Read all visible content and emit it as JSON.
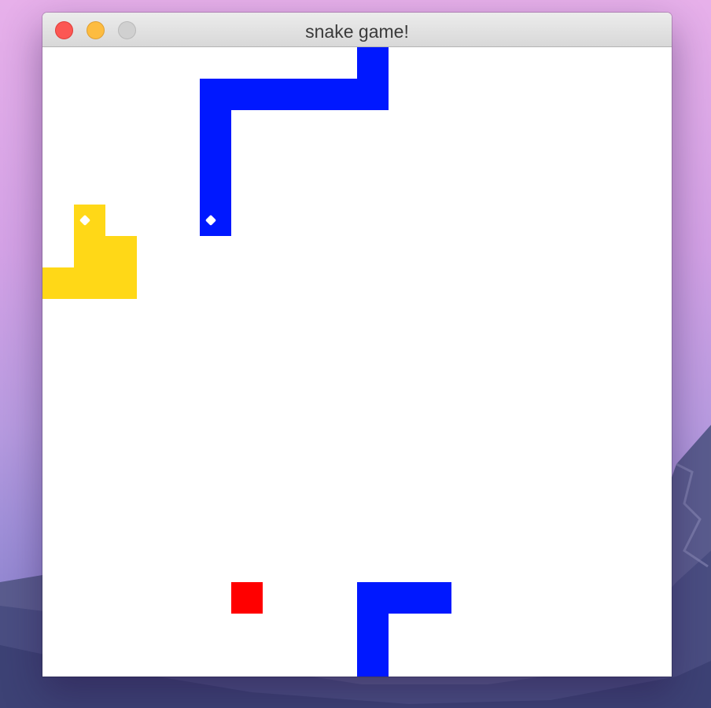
{
  "window": {
    "title": "snake game!"
  },
  "colors": {
    "board": "#ffffff",
    "player_snake": "#0018ff",
    "enemy_snake": "#ffd817",
    "food": "#ff0000",
    "eye": "#ffffff"
  },
  "game": {
    "grid_columns": 20,
    "grid_rows": 20,
    "snakes": [
      {
        "name": "blue-snake",
        "color": "#0018ff",
        "head": [
          5,
          5
        ],
        "direction": "down",
        "cells": [
          [
            5,
            5
          ],
          [
            5,
            4
          ],
          [
            5,
            3
          ],
          [
            5,
            2
          ],
          [
            6,
            1
          ],
          [
            7,
            1
          ],
          [
            8,
            1
          ],
          [
            9,
            1
          ],
          [
            10,
            1
          ],
          [
            10,
            0
          ],
          [
            5,
            1
          ],
          [
            10,
            19
          ],
          [
            10,
            18
          ],
          [
            11,
            17
          ],
          [
            10,
            17
          ],
          [
            12,
            17
          ]
        ]
      },
      {
        "name": "yellow-snake",
        "color": "#ffd817",
        "head": [
          1,
          5
        ],
        "direction": "up",
        "cells": [
          [
            1,
            5
          ],
          [
            1,
            6
          ],
          [
            2,
            6
          ],
          [
            2,
            7
          ],
          [
            1,
            7
          ],
          [
            0,
            7
          ]
        ]
      }
    ],
    "food": [
      6,
      17
    ]
  }
}
